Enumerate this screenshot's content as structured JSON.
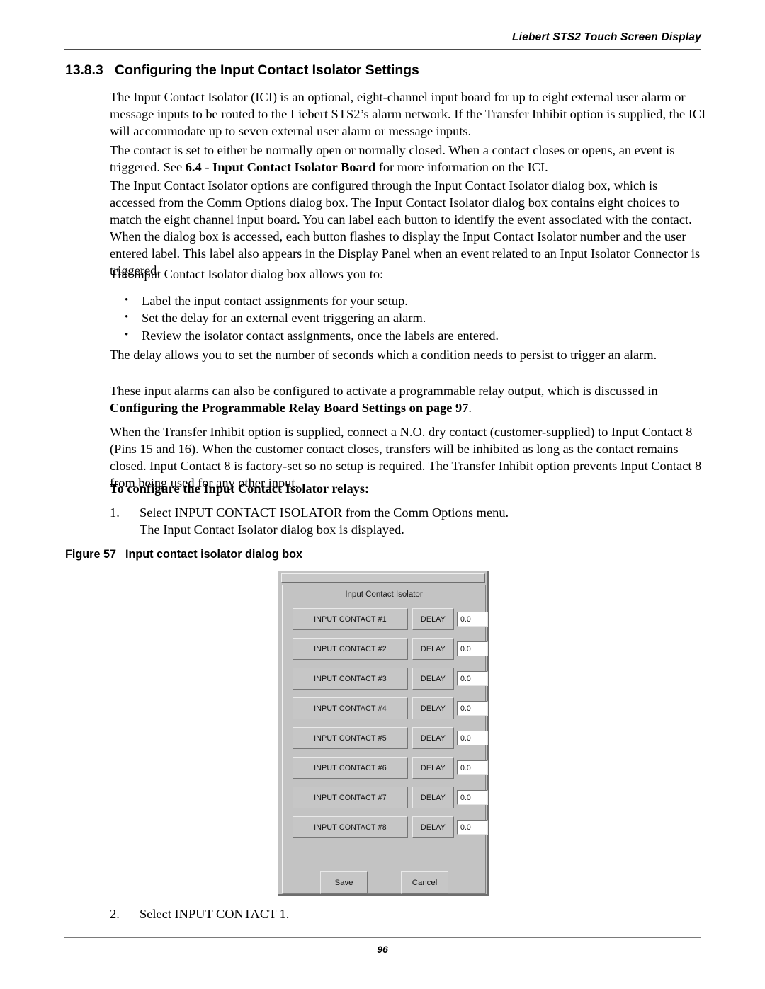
{
  "header": {
    "running_head": "Liebert STS2 Touch Screen Display"
  },
  "section": {
    "number": "13.8.3",
    "title": "Configuring the Input Contact Isolator Settings"
  },
  "paragraphs": {
    "p1": "The Input Contact Isolator (ICI) is an optional, eight-channel input board for up to eight external user alarm or message inputs to be routed to the Liebert STS2’s alarm network. If the Transfer Inhibit option is supplied, the ICI will accommodate up to seven external user alarm or message inputs.",
    "p2_a": "The contact is set to either be normally open or normally closed. When a contact closes or opens, an event is triggered. See ",
    "p2_bold": "6.4 - Input Contact Isolator Board",
    "p2_b": " for more information on the ICI.",
    "p3": "The Input Contact Isolator options are configured through the Input Contact Isolator dialog box, which is accessed from the Comm Options dialog box. The Input Contact Isolator dialog box contains eight choices to match the eight channel input board. You can label each button to identify the event associated with the contact. When the dialog box is accessed, each button flashes to display the Input Contact Isolator number and the user entered label. This label also appears in the Display Panel when an event related to an Input Isolator Connector is triggered.",
    "p4": "The Input Contact Isolator dialog box allows you to:",
    "p5": "The delay allows you to set the number of seconds which a condition needs to persist to trigger an alarm.",
    "p6_a": "These input alarms can also be configured to activate a programmable relay output, which is discussed in ",
    "p6_bold": "Configuring the Programmable Relay Board Settings on page 97",
    "p6_b": ".",
    "p7": "When the Transfer Inhibit option is supplied, connect a N.O. dry contact (customer-supplied) to Input Contact 8 (Pins 15 and 16). When the customer contact closes, transfers will be inhibited as long as the contact remains closed. Input Contact 8 is factory-set so no setup is required. The Transfer Inhibit option prevents Input Contact 8 from being used for any other input."
  },
  "bullets": [
    "Label the input contact assignments for your setup.",
    "Set the delay for an external event triggering an alarm.",
    "Review the isolator contact assignments, once the labels are entered."
  ],
  "procedure": {
    "heading": "To configure the Input Contact Isolator relays:",
    "step1_number": "1.",
    "step1_text": "Select INPUT CONTACT ISOLATOR from the Comm Options menu.",
    "step1_result": "The Input Contact Isolator dialog box is displayed.",
    "step2_number": "2.",
    "step2_text": "Select INPUT CONTACT 1."
  },
  "figure": {
    "label": "Figure 57",
    "caption": "Input contact isolator dialog box"
  },
  "dialog": {
    "title": "Input Contact Isolator",
    "delay_label": "DELAY",
    "rows": [
      {
        "contact": "INPUT CONTACT #1",
        "delay_label": "DELAY",
        "delay_value": "0.0"
      },
      {
        "contact": "INPUT CONTACT #2",
        "delay_label": "DELAY",
        "delay_value": "0.0"
      },
      {
        "contact": "INPUT CONTACT #3",
        "delay_label": "DELAY",
        "delay_value": "0.0"
      },
      {
        "contact": "INPUT CONTACT #4",
        "delay_label": "DELAY",
        "delay_value": "0.0"
      },
      {
        "contact": "INPUT CONTACT #5",
        "delay_label": "DELAY",
        "delay_value": "0.0"
      },
      {
        "contact": "INPUT CONTACT #6",
        "delay_label": "DELAY",
        "delay_value": "0.0"
      },
      {
        "contact": "INPUT CONTACT #7",
        "delay_label": "DELAY",
        "delay_value": "0.0"
      },
      {
        "contact": "INPUT CONTACT #8",
        "delay_label": "DELAY",
        "delay_value": "0.0"
      }
    ],
    "save_label": "Save",
    "cancel_label": "Cancel"
  },
  "footer": {
    "page_number": "96"
  },
  "colors": {
    "dialog_face": "#c3c3c3",
    "button_face": "#c6c6c6",
    "field_background": "#ffffff",
    "text": "#000000"
  }
}
